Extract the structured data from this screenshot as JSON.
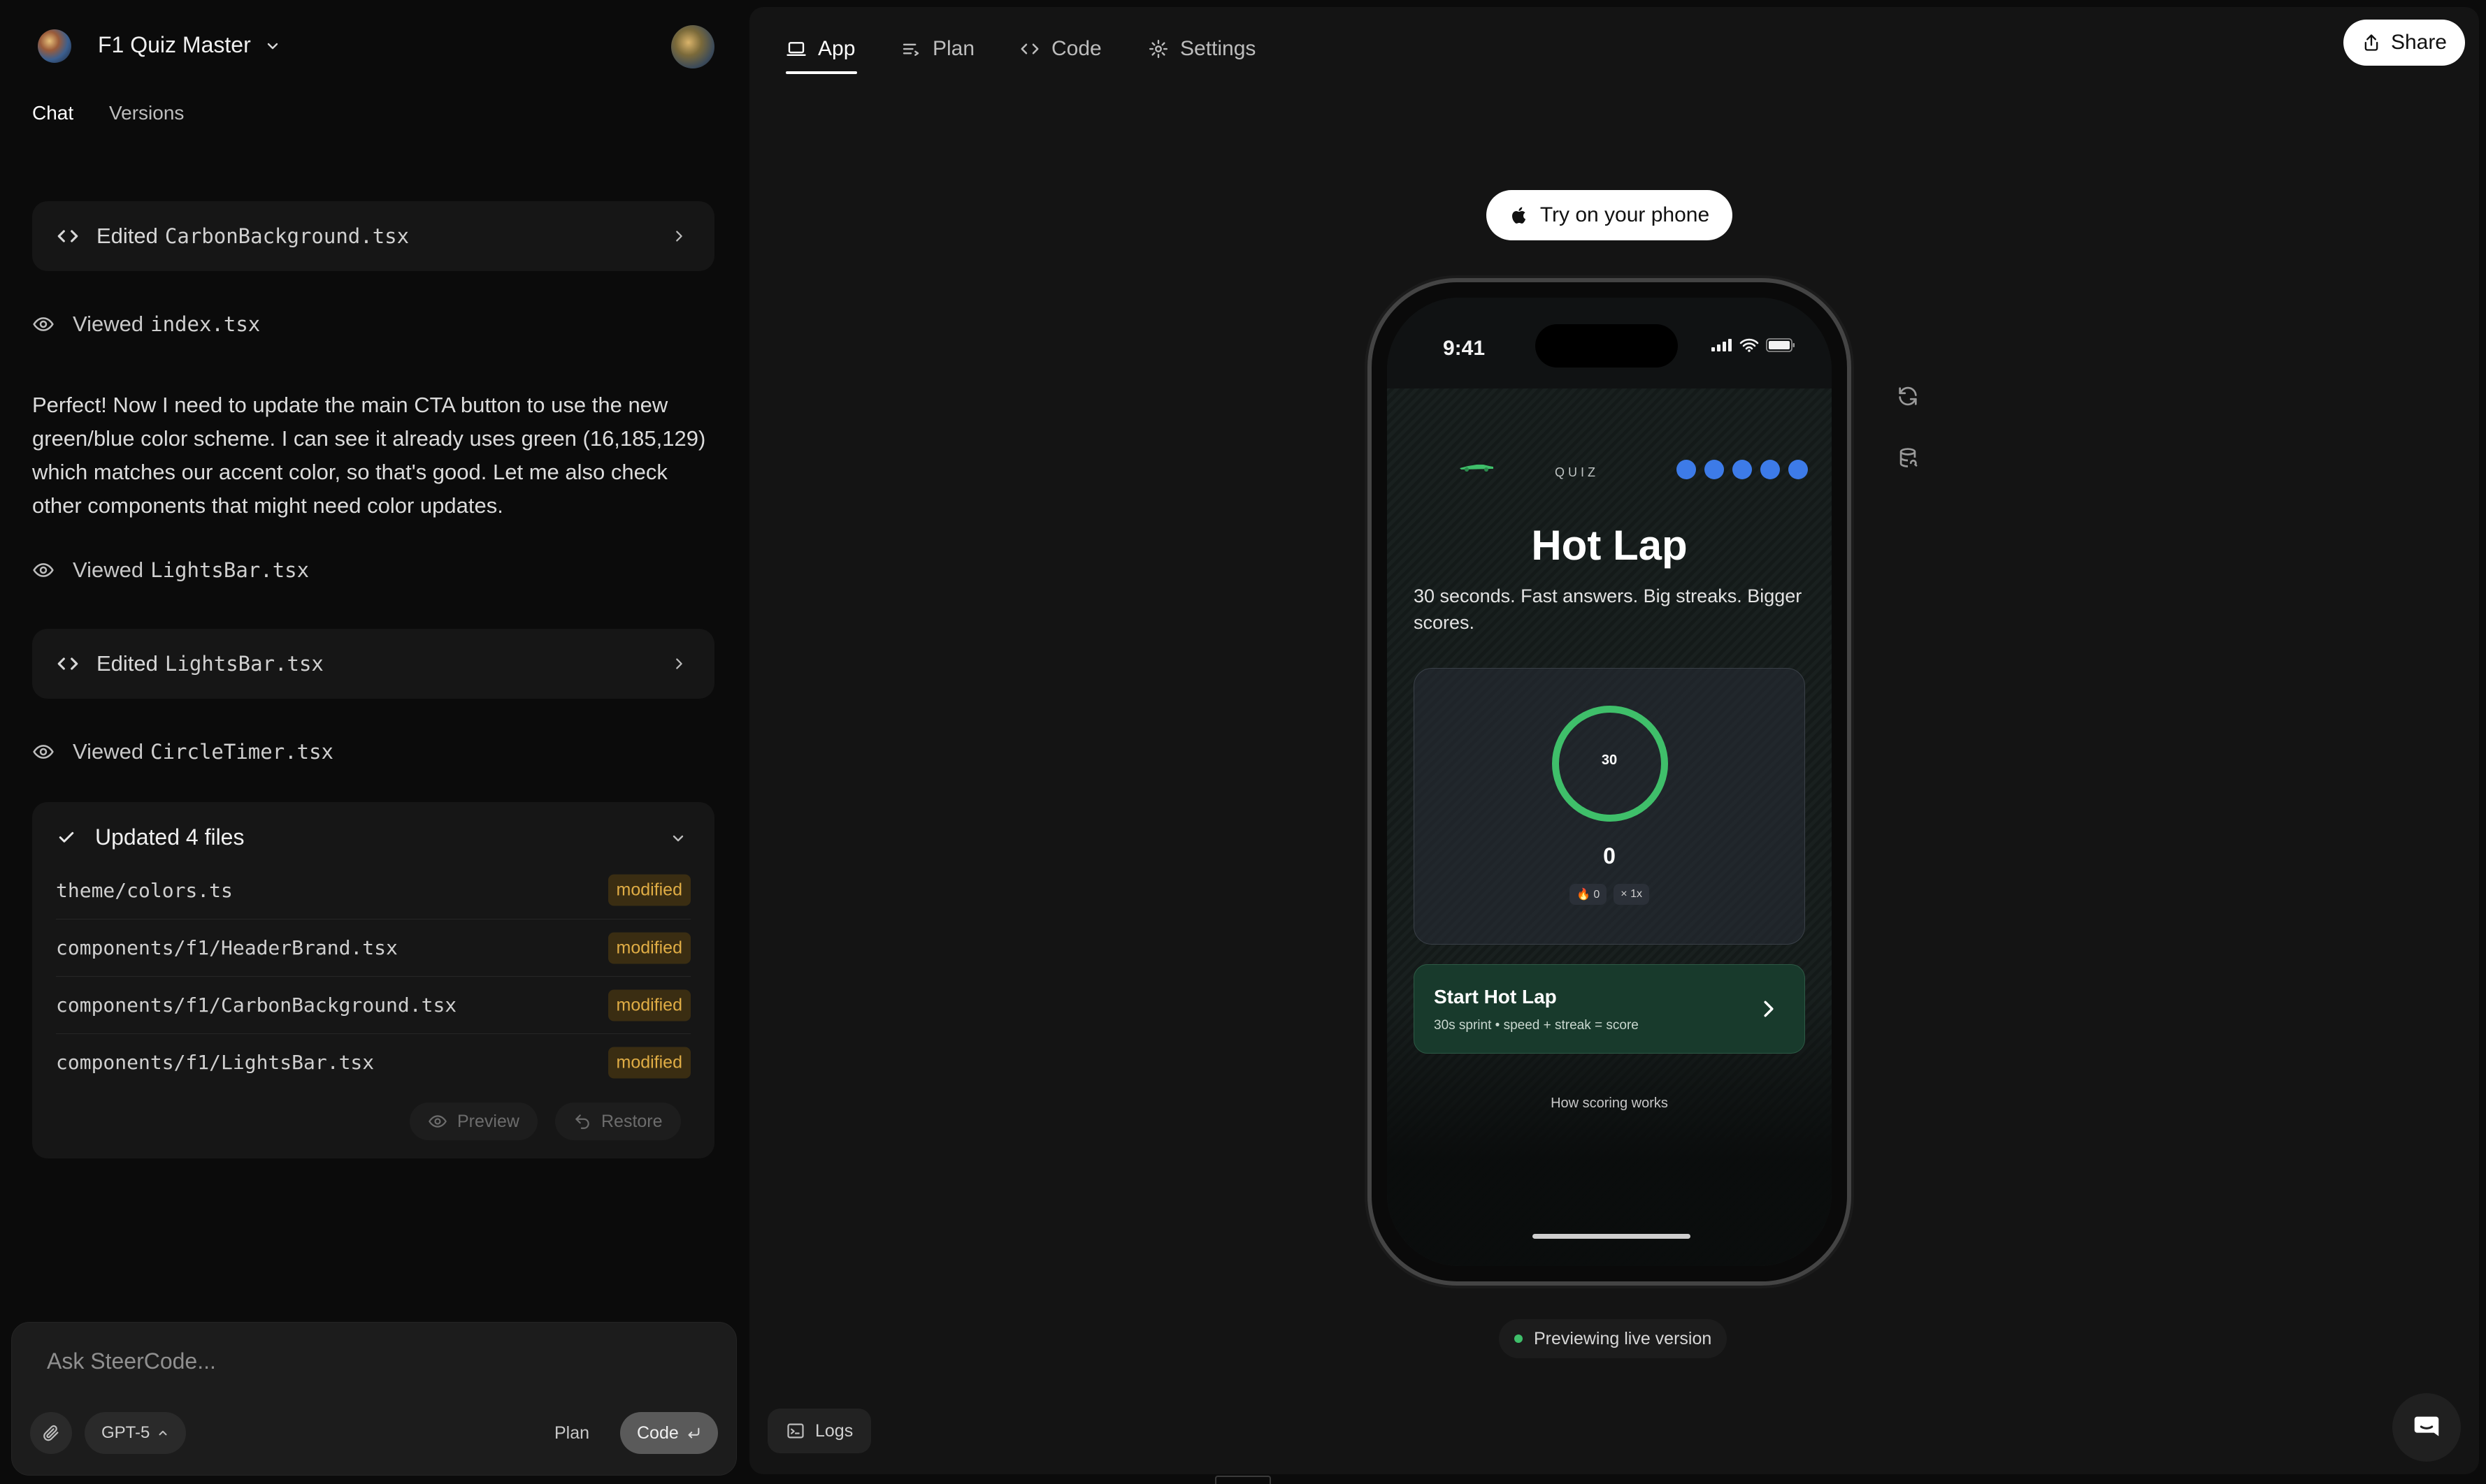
{
  "project": {
    "title": "F1 Quiz Master"
  },
  "left_tabs": {
    "chat": "Chat",
    "versions": "Versions"
  },
  "chat": {
    "edited_1": {
      "label": "Edited",
      "file": "CarbonBackground.tsx"
    },
    "viewed_1": {
      "label": "Viewed",
      "file": "index.tsx"
    },
    "message": "Perfect! Now I need to update the main CTA button to use the new green/blue color scheme. I can see it already uses green (16,185,129) which matches our accent color, so that's good. Let me also check other components that might need color updates.",
    "viewed_2": {
      "label": "Viewed",
      "file": "LightsBar.tsx"
    },
    "edited_2": {
      "label": "Edited",
      "file": "LightsBar.tsx"
    },
    "viewed_3": {
      "label": "Viewed",
      "file": "CircleTimer.tsx"
    },
    "updated": {
      "title": "Updated 4 files",
      "files": [
        {
          "name": "theme/colors.ts",
          "status": "modified"
        },
        {
          "name": "components/f1/HeaderBrand.tsx",
          "status": "modified"
        },
        {
          "name": "components/f1/CarbonBackground.tsx",
          "status": "modified"
        },
        {
          "name": "components/f1/LightsBar.tsx",
          "status": "modified"
        }
      ],
      "preview_label": "Preview",
      "restore_label": "Restore"
    }
  },
  "composer": {
    "placeholder": "Ask SteerCode...",
    "model": "GPT-5",
    "plan_label": "Plan",
    "code_label": "Code"
  },
  "right_tabs": {
    "app": "App",
    "plan": "Plan",
    "code": "Code",
    "settings": "Settings"
  },
  "share_label": "Share",
  "try_phone_label": "Try on your phone",
  "phone": {
    "time": "9:41",
    "quiz_label": "QUIZ",
    "lights_count": 5,
    "title": "Hot Lap",
    "subtitle": "30 seconds. Fast answers. Big streaks. Bigger scores.",
    "timer": "30",
    "score": "0",
    "streak_badge": "🔥 0",
    "multiplier_badge": "× 1x",
    "cta_title": "Start Hot Lap",
    "cta_subtitle": "30s sprint • speed + streak = score",
    "how_link": "How scoring works"
  },
  "preview_status": "Previewing live version",
  "logs_label": "Logs",
  "colors": {
    "accent_green": "#3fbf6a",
    "light_blue": "#3d7be8",
    "badge_text": "#e0ad45",
    "badge_bg": "#3a2d12"
  }
}
